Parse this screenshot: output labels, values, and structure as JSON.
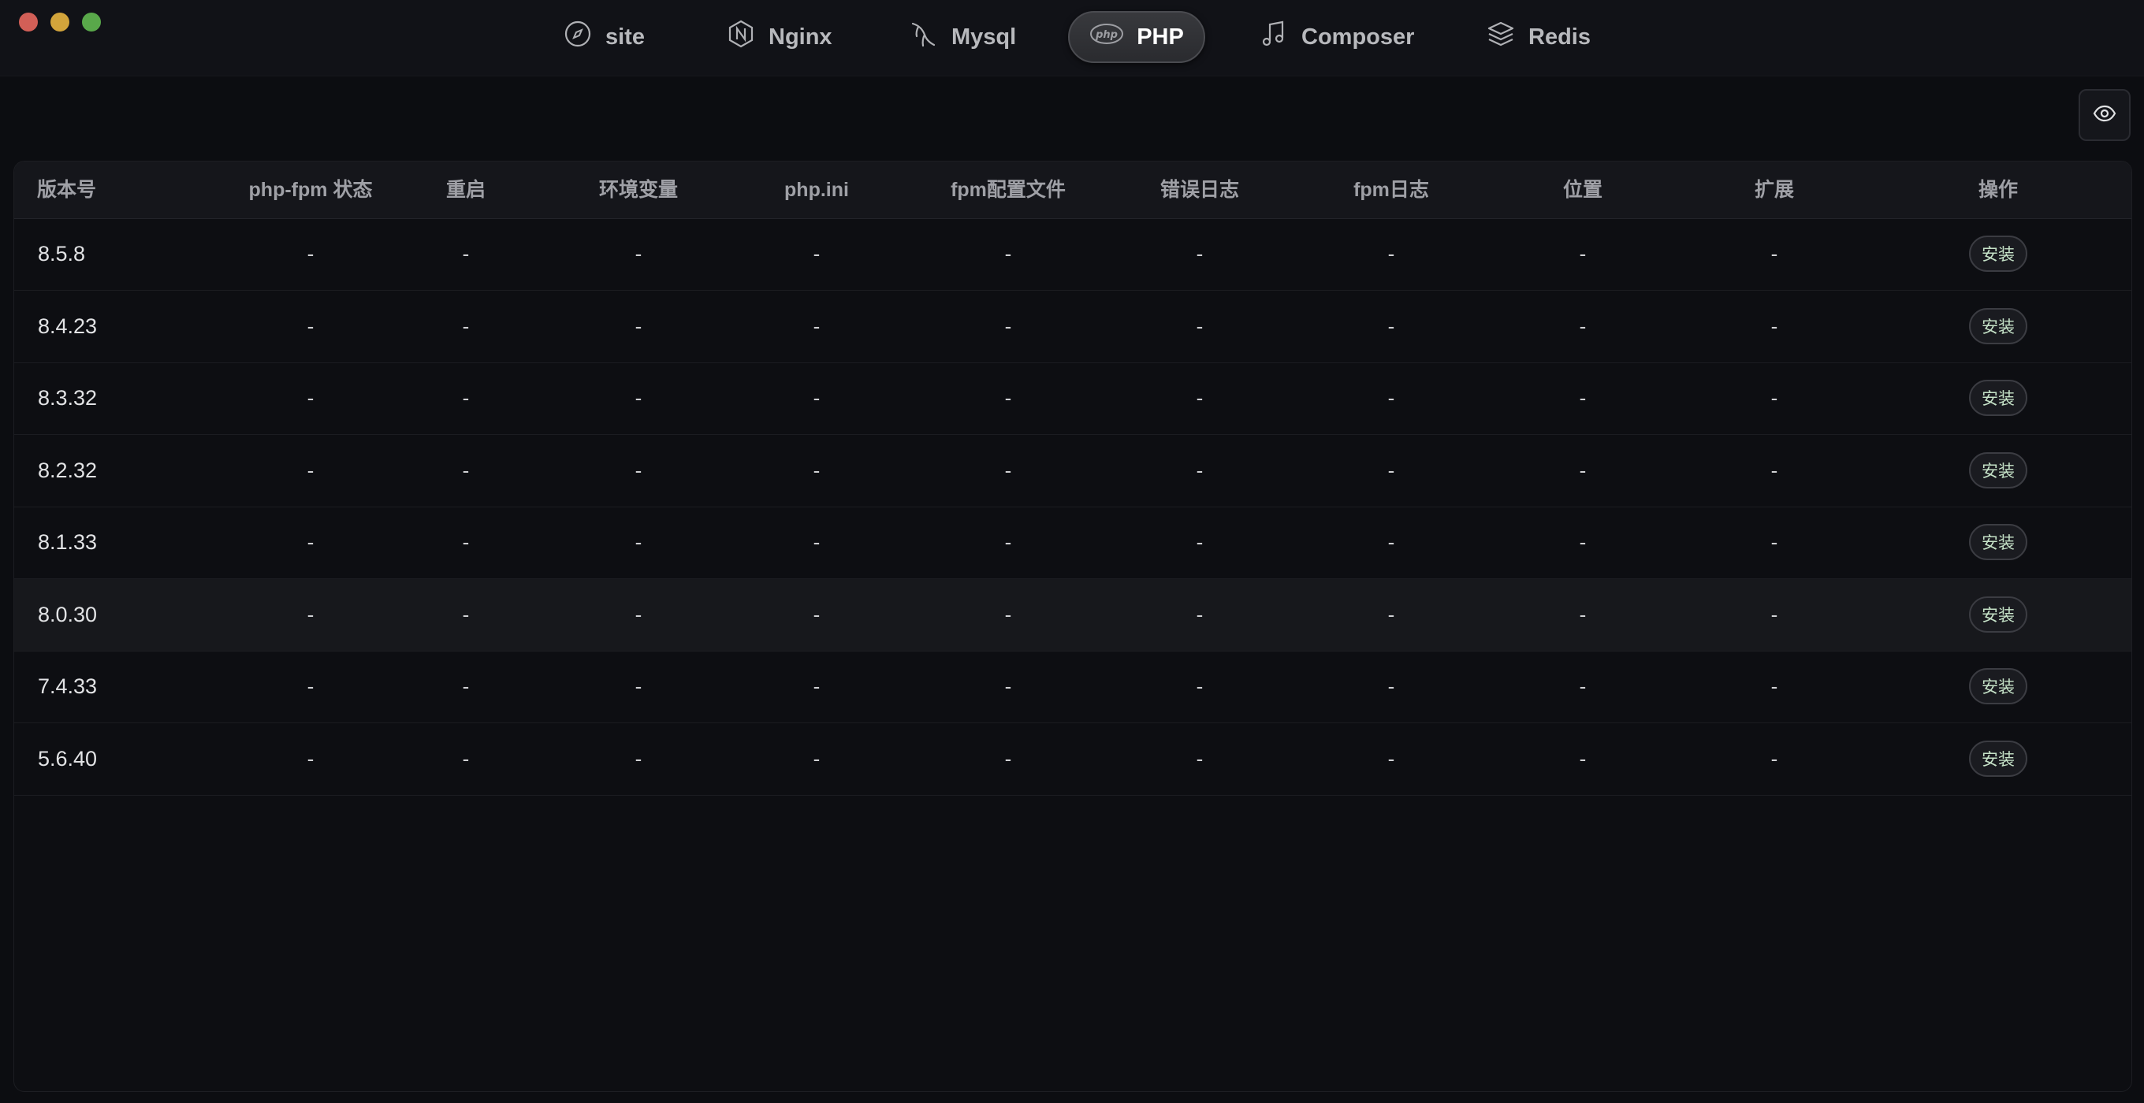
{
  "nav": {
    "items": [
      {
        "label": "site",
        "icon": "compass-icon"
      },
      {
        "label": "Nginx",
        "icon": "nginx-icon"
      },
      {
        "label": "Mysql",
        "icon": "mysql-dolphin-icon"
      },
      {
        "label": "PHP",
        "icon": "php-icon",
        "active": true
      },
      {
        "label": "Composer",
        "icon": "music-note-icon"
      },
      {
        "label": "Redis",
        "icon": "layers-icon"
      }
    ],
    "php_badge": "php"
  },
  "toolbar": {
    "toggle_visibility_icon": "eye-icon"
  },
  "table": {
    "headers": [
      "版本号",
      "php-fpm 状态",
      "重启",
      "环境变量",
      "php.ini",
      "fpm配置文件",
      "错误日志",
      "fpm日志",
      "位置",
      "扩展",
      "操作"
    ],
    "placeholder": "-",
    "action_label": "安装",
    "rows": [
      {
        "version": "8.5.8"
      },
      {
        "version": "8.4.23"
      },
      {
        "version": "8.3.32"
      },
      {
        "version": "8.2.32"
      },
      {
        "version": "8.1.33"
      },
      {
        "version": "8.0.30",
        "hovered": true
      },
      {
        "version": "7.4.33"
      },
      {
        "version": "5.6.40"
      }
    ]
  },
  "colors": {
    "background": "#0c0d11",
    "accent_text": "#c6e3c8",
    "close": "#d25f57",
    "minimize": "#d2a43b",
    "zoom": "#59a84a"
  }
}
